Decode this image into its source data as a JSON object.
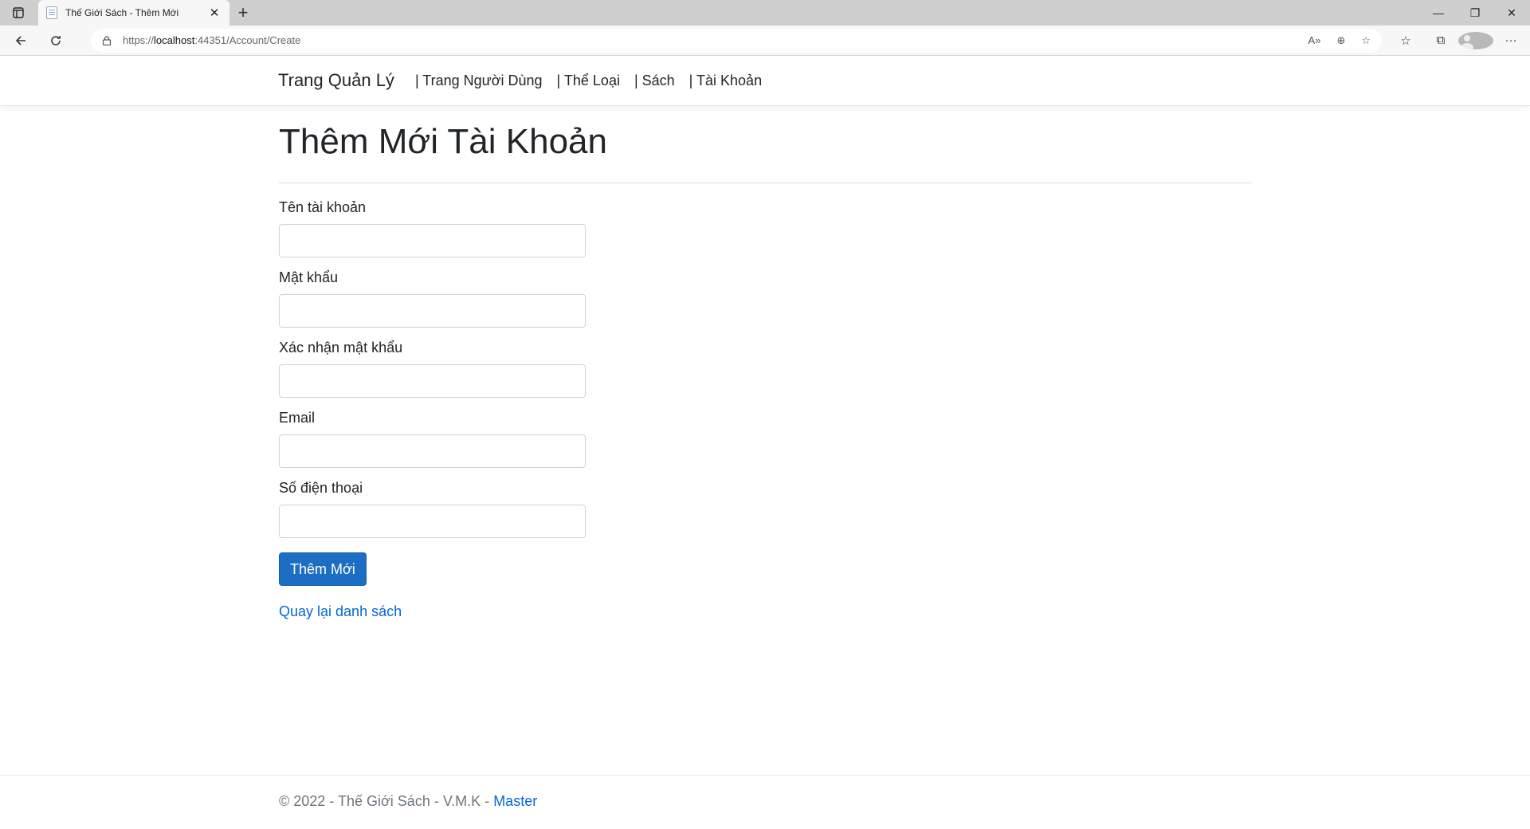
{
  "browser": {
    "tab_title": "Thế Giới Sách - Thêm Mới",
    "url_prefix": "https://",
    "url_host": "localhost",
    "url_rest": ":44351/Account/Create"
  },
  "nav": {
    "brand": "Trang Quản Lý",
    "links": [
      "| Trang Người Dùng",
      "| Thể Loại",
      "| Sách",
      "| Tài Khoản"
    ]
  },
  "main": {
    "title": "Thêm Mới Tài Khoản",
    "fields": [
      {
        "label": "Tên tài khoản",
        "value": ""
      },
      {
        "label": "Mật khẩu",
        "value": ""
      },
      {
        "label": "Xác nhận mật khẩu",
        "value": ""
      },
      {
        "label": "Email",
        "value": ""
      },
      {
        "label": "Số điện thoại",
        "value": ""
      }
    ],
    "submit_label": "Thêm Mới",
    "back_link": "Quay lại danh sách"
  },
  "footer": {
    "text": "© 2022 - Thế Giới Sách - V.M.K - ",
    "link": "Master"
  },
  "colors": {
    "primary": "#1b6ec2",
    "link": "#0366d6"
  }
}
